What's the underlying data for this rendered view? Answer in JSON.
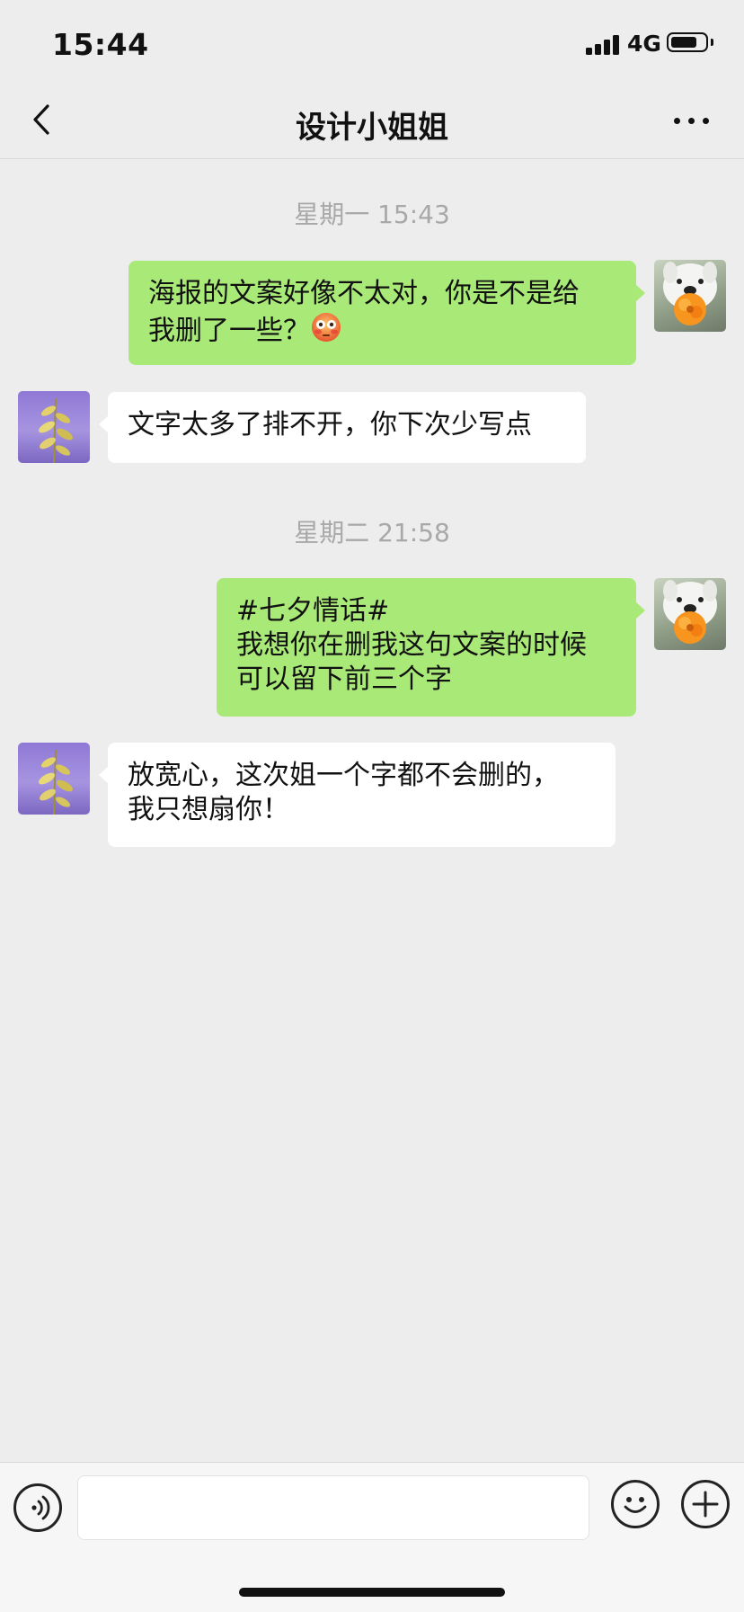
{
  "status_bar": {
    "time": "15:44",
    "network": "4G"
  },
  "nav": {
    "title": "设计小姐姐",
    "back_icon": "chevron-left-icon",
    "more_icon": "ellipsis-icon"
  },
  "chat": {
    "timestamps": [
      "星期一 15:43",
      "星期二 21:58"
    ],
    "messages": [
      {
        "sender": "me",
        "lines": [
          "海报的文案好像不太对，你是不是给",
          "我删了一些？"
        ],
        "emoji": "flushed-face-emoji"
      },
      {
        "sender": "other",
        "lines": [
          "文字太多了排不开，你下次少写点"
        ]
      },
      {
        "sender": "me",
        "lines": [
          "#七夕情话#",
          "我想你在删我这句文案的时候",
          "可以留下前三个字"
        ]
      },
      {
        "sender": "other",
        "lines": [
          "放宽心，这次姐一个字都不会删的，",
          "我只想扇你！"
        ]
      }
    ]
  },
  "input_bar": {
    "voice_icon": "voice-icon",
    "emoji_icon": "smiley-icon",
    "plus_icon": "plus-icon",
    "value": ""
  },
  "colors": {
    "background": "#ededed",
    "my_bubble": "#a9e978",
    "their_bubble": "#ffffff",
    "timestamp": "#a8a8a8"
  }
}
